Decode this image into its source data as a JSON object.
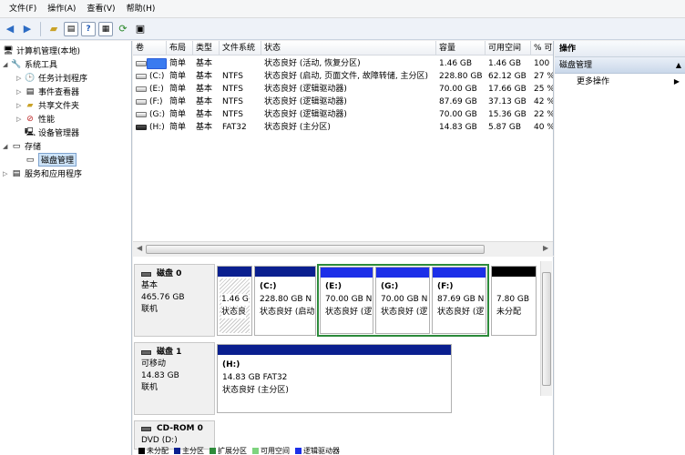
{
  "menu": [
    "文件(F)",
    "操作(A)",
    "查看(V)",
    "帮助(H)"
  ],
  "toolbar_icons": [
    "back-arrow-icon",
    "forward-arrow-icon",
    "up-folder-icon",
    "show-hide-tree-icon",
    "help-icon",
    "list-view-icon",
    "refresh-icon",
    "export-icon"
  ],
  "tree": {
    "root": "计算机管理(本地)",
    "system_tools": "系统工具",
    "task_scheduler": "任务计划程序",
    "event_viewer": "事件查看器",
    "shared_folders": "共享文件夹",
    "performance": "性能",
    "device_manager": "设备管理器",
    "storage": "存储",
    "disk_management": "磁盘管理",
    "services": "服务和应用程序"
  },
  "volume_table": {
    "columns": [
      "卷",
      "布局",
      "类型",
      "文件系统",
      "状态",
      "容量",
      "可用空间",
      "% 可"
    ],
    "rows": [
      {
        "vol": "",
        "layout": "简单",
        "type": "基本",
        "fs": "",
        "status": "状态良好 (活动, 恢复分区)",
        "capacity": "1.46 GB",
        "free": "1.46 GB",
        "pct": "100"
      },
      {
        "vol": "(C:)",
        "layout": "简单",
        "type": "基本",
        "fs": "NTFS",
        "status": "状态良好 (启动, 页面文件, 故障转储, 主分区)",
        "capacity": "228.80 GB",
        "free": "62.12 GB",
        "pct": "27 %"
      },
      {
        "vol": "(E:)",
        "layout": "简单",
        "type": "基本",
        "fs": "NTFS",
        "status": "状态良好 (逻辑驱动器)",
        "capacity": "70.00 GB",
        "free": "17.66 GB",
        "pct": "25 %"
      },
      {
        "vol": "(F:)",
        "layout": "简单",
        "type": "基本",
        "fs": "NTFS",
        "status": "状态良好 (逻辑驱动器)",
        "capacity": "87.69 GB",
        "free": "37.13 GB",
        "pct": "42 %"
      },
      {
        "vol": "(G:)",
        "layout": "简单",
        "type": "基本",
        "fs": "NTFS",
        "status": "状态良好 (逻辑驱动器)",
        "capacity": "70.00 GB",
        "free": "15.36 GB",
        "pct": "22 %"
      },
      {
        "vol": "(H:)",
        "layout": "简单",
        "type": "基本",
        "fs": "FAT32",
        "status": "状态良好 (主分区)",
        "capacity": "14.83 GB",
        "free": "5.87 GB",
        "pct": "40 %"
      }
    ]
  },
  "disks": {
    "disk0": {
      "name": "磁盘 0",
      "type": "基本",
      "size": "465.76 GB",
      "state": "联机"
    },
    "disk1": {
      "name": "磁盘 1",
      "type": "可移动",
      "size": "14.83 GB",
      "state": "联机"
    },
    "cdrom": {
      "name": "CD-ROM 0",
      "type": "DVD (D:)"
    }
  },
  "partitions": {
    "p_recovery": {
      "size": "1.46 G",
      "status": "状态良"
    },
    "p_c": {
      "label": "(C:)",
      "size": "228.80 GB N",
      "status": "状态良好 (启动"
    },
    "p_e": {
      "label": "(E:)",
      "size": "70.00 GB N",
      "status": "状态良好 (逻"
    },
    "p_g": {
      "label": "(G:)",
      "size": "70.00 GB N",
      "status": "状态良好 (逻"
    },
    "p_f": {
      "label": "(F:)",
      "size": "87.69 GB N",
      "status": "状态良好 (逻"
    },
    "p_unalloc": {
      "size": "7.80 GB",
      "status": "未分配"
    },
    "p_h": {
      "label": "(H:)",
      "size": "14.83 GB FAT32",
      "status": "状态良好 (主分区)"
    }
  },
  "legend": [
    "未分配",
    "主分区",
    "扩展分区",
    "可用空间",
    "逻辑驱动器"
  ],
  "colors": {
    "primary": "#0a1f8f",
    "logical": "#1c2fe8",
    "unallocated": "#000000",
    "free_space": "#7ed37e",
    "extended": "#2e8b3a",
    "selection": "#2b8a3a"
  },
  "actions": {
    "header": "操作",
    "section": "磁盘管理",
    "more": "更多操作"
  }
}
